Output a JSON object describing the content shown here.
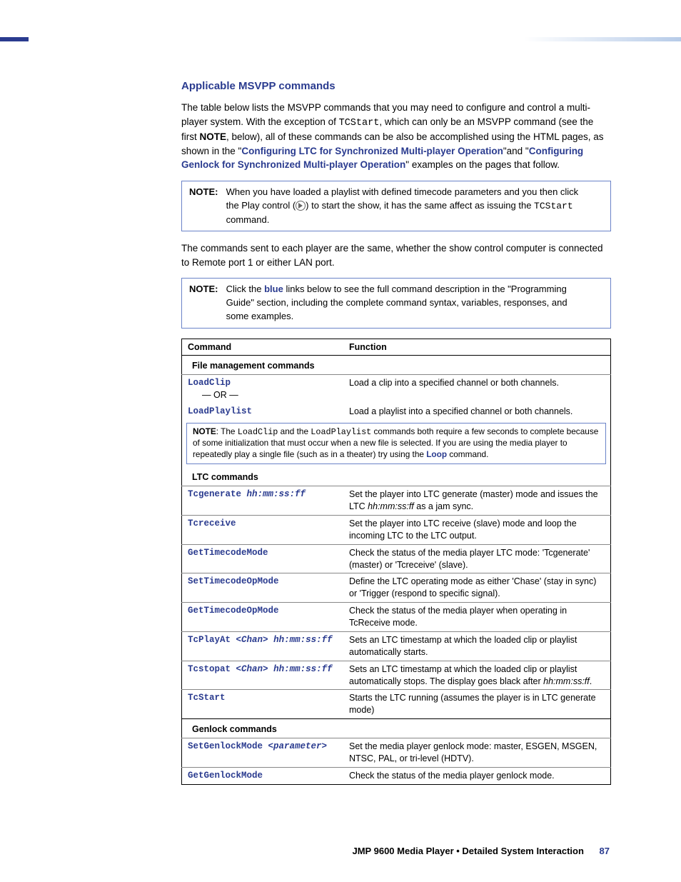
{
  "heading": "Applicable MSVPP commands",
  "para1_a": "The table below lists the MSVPP commands that you may need to configure and control a multi-player system. With the exception of ",
  "tcstart_sm": "TCStart",
  "para1_b": ", which can only be an MSVPP command (see the first ",
  "note_bold": "NOTE",
  "para1_c": ", below), all of these commands can be also be accomplished using the HTML pages, as shown in the \"",
  "link1": "Configuring LTC for Synchronized Multi-player Operation",
  "para1_d": "\"and \"",
  "link2": "Configuring Genlock for Synchronized Multi-player Operation",
  "para1_e": "\" examples on the pages that follow.",
  "note1_label": "NOTE:",
  "note1_a": "When you have loaded a playlist with defined timecode parameters and you then click the Play control (",
  "note1_b": ") to start the show, it has the same affect as issuing the ",
  "note1_c": " command.",
  "para2": "The commands sent to each player are the same, whether the show control computer is connected to Remote port 1 or either LAN port.",
  "note2_label": "NOTE:",
  "note2_a": "Click the ",
  "note2_blue": "blue",
  "note2_b": " links below to see the full command description in the \"Programming Guide\" section, including the complete command syntax, variables, responses, and some examples.",
  "th_cmd": "Command",
  "th_fn": "Function",
  "grp1": "File management commands",
  "r1c": "LoadClip",
  "r1or": "— OR —",
  "r1f": "Load a clip into a specified channel or both channels.",
  "r2c": "LoadPlaylist",
  "r2f": "Load a playlist into a specified channel or both channels.",
  "inote_lbl": "NOTE",
  "inote_a": "The ",
  "inote_m1": "LoadClip",
  "inote_b": " and the ",
  "inote_m2": "LoadPlaylist",
  "inote_c": " commands both require a few seconds to complete because of some initialization that must occur when a new file is selected. If you are using the media player to repeatedly play a single file (such as in a theater) try using the ",
  "inote_loop": "Loop",
  "inote_d": " command.",
  "grp2": "LTC commands",
  "r3c1": "Tcgenerate",
  "r3c2": "hh:mm:ss:ff",
  "r3f_a": "Set the player into LTC generate (master) mode and issues the LTC ",
  "r3f_i": "hh:mm:ss:ff",
  "r3f_b": " as a jam sync.",
  "r4c": "Tcreceive",
  "r4f": "Set the player into LTC receive (slave) mode and loop the incoming LTC to the LTC output.",
  "r5c": "GetTimecodeMode",
  "r5f": "Check the status of the media player LTC mode: 'Tcgenerate' (master) or 'Tcreceive' (slave).",
  "r6c": "SetTimecodeOpMode",
  "r6f": "Define the LTC operating mode as either 'Chase' (stay in sync) or 'Trigger (respond to specific signal).",
  "r7c": "GetTimecodeOpMode",
  "r7f": "Check the status of the media player when operating in TcReceive mode.",
  "r8c1": "TcPlayAt",
  "r8c2": "<Chan>",
  "r8c3": "hh:mm:ss:ff",
  "r8f": "Sets an LTC timestamp at which the loaded clip or playlist automatically starts.",
  "r9c1": "Tcstopat",
  "r9c2": "<Chan>",
  "r9c3": "hh:mm:ss:ff",
  "r9f_a": "Sets an LTC timestamp at which the loaded clip or playlist automatically stops. The display goes black after ",
  "r9f_i": "hh:mm:ss:ff",
  "r9f_b": ".",
  "r10c": "TcStart",
  "r10f": "Starts the LTC running (assumes the player is in LTC generate mode)",
  "grp3": "Genlock commands",
  "r11c1": "SetGenlockMode",
  "r11c2": "<parameter>",
  "r11f": "Set the media player genlock mode: master, ESGEN, MSGEN, NTSC, PAL, or tri-level (HDTV).",
  "r12c": "GetGenlockMode",
  "r12f": "Check the status of the media player genlock mode.",
  "footer_a": "JMP 9600 Media Player • Detailed System Interaction",
  "footer_pg": "87"
}
